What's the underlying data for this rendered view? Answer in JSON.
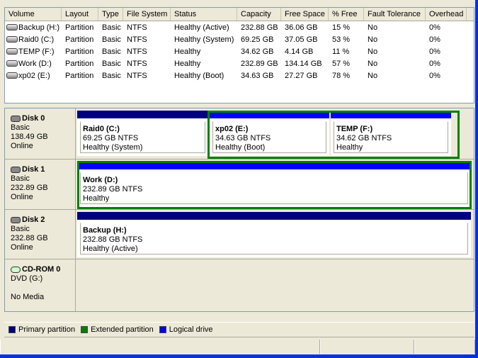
{
  "columns": [
    "Volume",
    "Layout",
    "Type",
    "File System",
    "Status",
    "Capacity",
    "Free Space",
    "% Free",
    "Fault Tolerance",
    "Overhead"
  ],
  "volumes": [
    [
      "Backup (H:)",
      "Partition",
      "Basic",
      "NTFS",
      "Healthy (Active)",
      "232.88 GB",
      "36.06 GB",
      "15 %",
      "No",
      "0%"
    ],
    [
      "Raid0 (C:)",
      "Partition",
      "Basic",
      "NTFS",
      "Healthy (System)",
      "69.25 GB",
      "37.05 GB",
      "53 %",
      "No",
      "0%"
    ],
    [
      "TEMP (F:)",
      "Partition",
      "Basic",
      "NTFS",
      "Healthy",
      "34.62 GB",
      "4.14 GB",
      "11 %",
      "No",
      "0%"
    ],
    [
      "Work (D:)",
      "Partition",
      "Basic",
      "NTFS",
      "Healthy",
      "232.89 GB",
      "134.14 GB",
      "57 %",
      "No",
      "0%"
    ],
    [
      "xp02 (E:)",
      "Partition",
      "Basic",
      "NTFS",
      "Healthy (Boot)",
      "34.63 GB",
      "27.27 GB",
      "78 %",
      "No",
      "0%"
    ]
  ],
  "disks": [
    {
      "name": "Disk 0",
      "type": "Basic",
      "size": "138.49 GB",
      "state": "Online",
      "partitions": [
        {
          "name": "Raid0  (C:)",
          "size": "69.25 GB NTFS",
          "status": "Healthy (System)",
          "kind": "primary"
        },
        {
          "name": "xp02  (E:)",
          "size": "34.63 GB NTFS",
          "status": "Healthy (Boot)",
          "kind": "logical"
        },
        {
          "name": "TEMP  (F:)",
          "size": "34.62 GB NTFS",
          "status": "Healthy",
          "kind": "logical"
        }
      ]
    },
    {
      "name": "Disk 1",
      "type": "Basic",
      "size": "232.89 GB",
      "state": "Online",
      "partitions": [
        {
          "name": "Work  (D:)",
          "size": "232.89 GB NTFS",
          "status": "Healthy",
          "kind": "logical"
        }
      ]
    },
    {
      "name": "Disk 2",
      "type": "Basic",
      "size": "232.88 GB",
      "state": "Online",
      "partitions": [
        {
          "name": "Backup  (H:)",
          "size": "232.88 GB NTFS",
          "status": "Healthy (Active)",
          "kind": "primary"
        }
      ]
    },
    {
      "name": "CD-ROM 0",
      "type": "DVD (G:)",
      "size": "",
      "state": "No Media",
      "partitions": []
    }
  ],
  "legend": [
    {
      "label": "Primary partition",
      "color": "#000080"
    },
    {
      "label": "Extended partition",
      "color": "#008000"
    },
    {
      "label": "Logical drive",
      "color": "#0000ff"
    }
  ],
  "colors": {
    "primary": "#000080",
    "extended": "#008000",
    "logical": "#0000ff"
  }
}
